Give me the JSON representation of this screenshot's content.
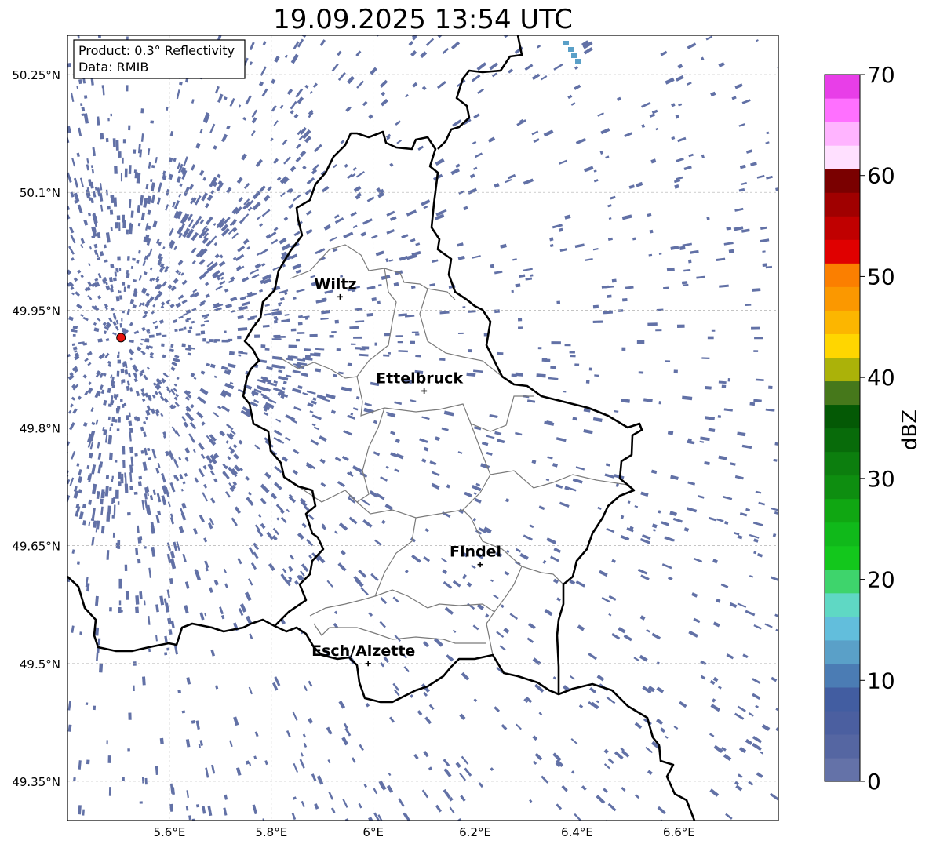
{
  "title": "19.09.2025 13:54 UTC",
  "info_box": {
    "product": "Product: 0.3° Reflectivity",
    "source": "Data: RMIB"
  },
  "lat_ticks": [
    {
      "value": 50.25,
      "label": "50.25°N"
    },
    {
      "value": 50.1,
      "label": "50.1°N"
    },
    {
      "value": 49.95,
      "label": "49.95°N"
    },
    {
      "value": 49.8,
      "label": "49.8°N"
    },
    {
      "value": 49.65,
      "label": "49.65°N"
    },
    {
      "value": 49.5,
      "label": "49.5°N"
    },
    {
      "value": 49.35,
      "label": "49.35°N"
    }
  ],
  "lon_ticks": [
    {
      "value": 5.6,
      "label": "5.6°E"
    },
    {
      "value": 5.8,
      "label": "5.8°E"
    },
    {
      "value": 6.0,
      "label": "6°E"
    },
    {
      "value": 6.2,
      "label": "6.2°E"
    },
    {
      "value": 6.4,
      "label": "6.4°E"
    },
    {
      "value": 6.6,
      "label": "6.6°E"
    }
  ],
  "extent": {
    "lon_min": 5.4,
    "lon_max": 6.795,
    "lat_min": 49.3,
    "lat_max": 50.3
  },
  "radar_site": {
    "lon": 5.505,
    "lat": 49.915,
    "color": "#e8120c"
  },
  "cities": [
    {
      "name": "Wiltz",
      "lon": 5.935,
      "lat": 49.967
    },
    {
      "name": "Ettelbruck",
      "lon": 6.1,
      "lat": 49.847
    },
    {
      "name": "Findel",
      "lon": 6.21,
      "lat": 49.626
    },
    {
      "name": "Esch/Alzette",
      "lon": 5.99,
      "lat": 49.5
    }
  ],
  "colorbar": {
    "label": "dBZ",
    "min": 0,
    "max": 70,
    "tick_labels": [
      "0",
      "10",
      "20",
      "30",
      "40",
      "50",
      "60",
      "70"
    ],
    "colors": [
      "#6472a8",
      "#5566a2",
      "#4b5fa0",
      "#425da1",
      "#4b7cb4",
      "#5aa0c8",
      "#62bedc",
      "#5fd8c4",
      "#3ed46c",
      "#13c71c",
      "#10b91a",
      "#10a712",
      "#0e8e10",
      "#0c7e0e",
      "#086b0a",
      "#045905",
      "#46781b",
      "#abb209",
      "#ffd600",
      "#fcb600",
      "#fb9800",
      "#fb7f00",
      "#e00000",
      "#c00000",
      "#a00000",
      "#7a0000",
      "#ffe0ff",
      "#ffb4ff",
      "#ff70ff",
      "#e83ee8"
    ]
  },
  "echo_color": "#6271a6"
}
